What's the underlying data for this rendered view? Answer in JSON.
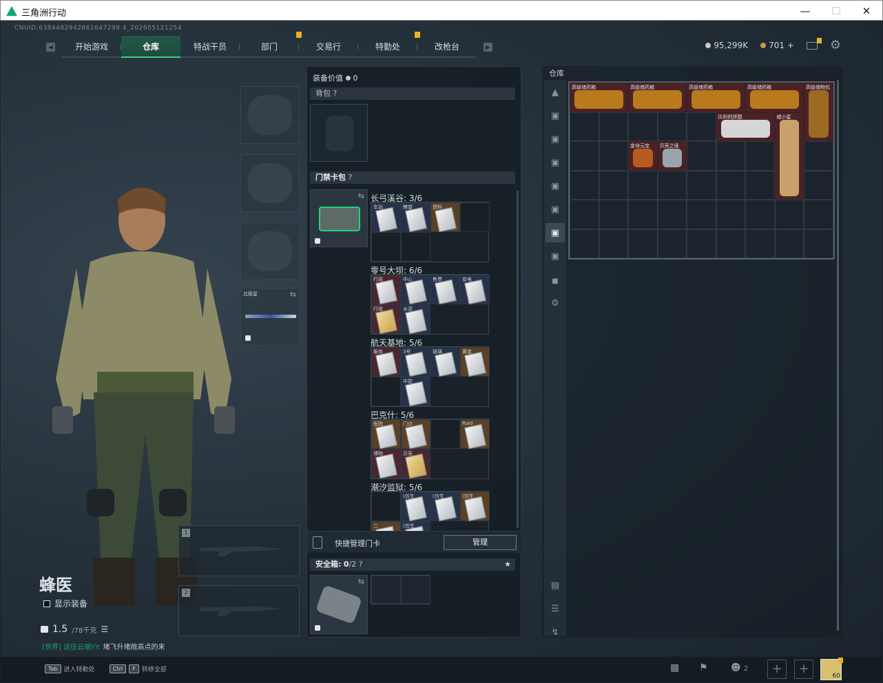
{
  "window": {
    "title": "三角洲行动"
  },
  "uid": "CNUID:6384482942861647299 4_202605121254",
  "nav": {
    "tabs": [
      {
        "label": "开始游戏"
      },
      {
        "label": "仓库",
        "active": true
      },
      {
        "label": "特战干员"
      },
      {
        "label": "部门",
        "badge": true
      },
      {
        "label": "交易行"
      },
      {
        "label": "特勤处",
        "badge": true
      },
      {
        "label": "改枪台"
      }
    ]
  },
  "currency": {
    "silver": "95,299K",
    "gold": "701",
    "gold_plus": "+"
  },
  "operator": {
    "name": "蜂医",
    "show_equipment": "显示装备",
    "weight": "1.5",
    "weight_max": "/78千克"
  },
  "chat": {
    "channel": "[世界]",
    "user": "这往云端YY:",
    "message": "堵飞升堵敞高点的来"
  },
  "equipment": {
    "value_label": "装备价值",
    "value": "0",
    "backpack_label": "背包",
    "card_bag_label": "门禁卡包",
    "weapon_slot_name": "北极星",
    "slot1": "1",
    "slot2": "2"
  },
  "maps": [
    {
      "name": "长弓溪谷: 3/6",
      "rows": [
        [
          {
            "c": "b",
            "l": "车站",
            "card": "w"
          },
          {
            "c": "b",
            "l": "瞭望",
            "card": "w"
          },
          {
            "c": "o",
            "l": "资料",
            "card": "w"
          },
          {
            "c": "e"
          }
        ],
        [
          {
            "c": "e"
          },
          {
            "c": "e"
          }
        ]
      ]
    },
    {
      "name": "零号大坝: 6/6",
      "rows": [
        [
          {
            "c": "r",
            "l": "行政",
            "card": "w"
          },
          {
            "c": "b",
            "l": "中心",
            "card": "w"
          },
          {
            "c": "b",
            "l": "售票",
            "card": "w"
          },
          {
            "c": "b",
            "l": "变电",
            "card": "w"
          }
        ],
        [
          {
            "c": "r",
            "l": "行政",
            "card": "y"
          },
          {
            "c": "b",
            "l": "水泥",
            "card": "w"
          }
        ]
      ]
    },
    {
      "name": "航天基地: 5/6",
      "rows": [
        [
          {
            "c": "r",
            "l": "服务",
            "card": "w"
          },
          {
            "c": "b",
            "l": "3号",
            "card": "w"
          },
          {
            "c": "b",
            "l": "玻璃",
            "card": "w"
          },
          {
            "c": "o",
            "l": "黄金",
            "card": "w"
          }
        ],
        [
          {
            "c": "e"
          },
          {
            "c": "b",
            "l": "中控",
            "card": "w"
          }
        ]
      ]
    },
    {
      "name": "巴克什: 5/6",
      "rows": [
        [
          {
            "c": "o",
            "l": "医院",
            "card": "w"
          },
          {
            "c": "o",
            "l": "门诊",
            "card": "w"
          },
          {
            "c": "e"
          },
          {
            "c": "o",
            "l": "Raid",
            "card": "w"
          }
        ],
        [
          {
            "c": "r",
            "l": "博物",
            "card": "w"
          },
          {
            "c": "r",
            "l": "贝壳",
            "card": "y"
          }
        ]
      ]
    },
    {
      "name": "潮汐监狱: 5/6",
      "rows": [
        [
          {
            "c": "e"
          },
          {
            "c": "b",
            "l": "(仿生",
            "card": "w"
          },
          {
            "c": "b",
            "l": "(仿生",
            "card": "w"
          },
          {
            "c": "o",
            "l": "(仿生",
            "card": "w"
          }
        ],
        [
          {
            "c": "o",
            "l": "二",
            "card": "w"
          },
          {
            "c": "b",
            "l": "(仿生",
            "card": "w"
          }
        ]
      ]
    }
  ],
  "quick_card": {
    "label": "快捷管理门卡",
    "manage": "管理"
  },
  "safe_box": {
    "label": "安全箱:",
    "value": "0",
    "max": "/2"
  },
  "warehouse": {
    "title": "仓库",
    "items": [
      {
        "label": "高级储药箱",
        "color": "#4a2226",
        "vis": "#b97a1e"
      },
      {
        "label": "高级储药箱",
        "color": "#4a2226",
        "vis": "#b97a1e"
      },
      {
        "label": "高级储药箱",
        "color": "#4a2226",
        "vis": "#b97a1e"
      },
      {
        "label": "高级储药箱",
        "color": "#4a2226",
        "vis": "#b97a1e"
      },
      {
        "label": "高级储物包",
        "color": "#4a2226",
        "vis": "#9c6a22"
      },
      {
        "label": "比利的拼图",
        "color": "#4a2226",
        "vis": "#d6d6d6"
      },
      {
        "label": "威小星",
        "color": "#4a2226",
        "vis": "#c8a26a"
      },
      {
        "label": "金块元宝",
        "color": "#4a2226",
        "vis": "#b85b1e"
      },
      {
        "label": "贝壳之境",
        "color": "#4a2226",
        "vis": "#9aa4ac"
      }
    ]
  },
  "bottom": {
    "key1": "Tab",
    "key1_label": "进入特勤处",
    "key2a": "Ctrl",
    "key2b": "F",
    "key2_label": "转移全部",
    "squad": "2",
    "level": "60"
  }
}
